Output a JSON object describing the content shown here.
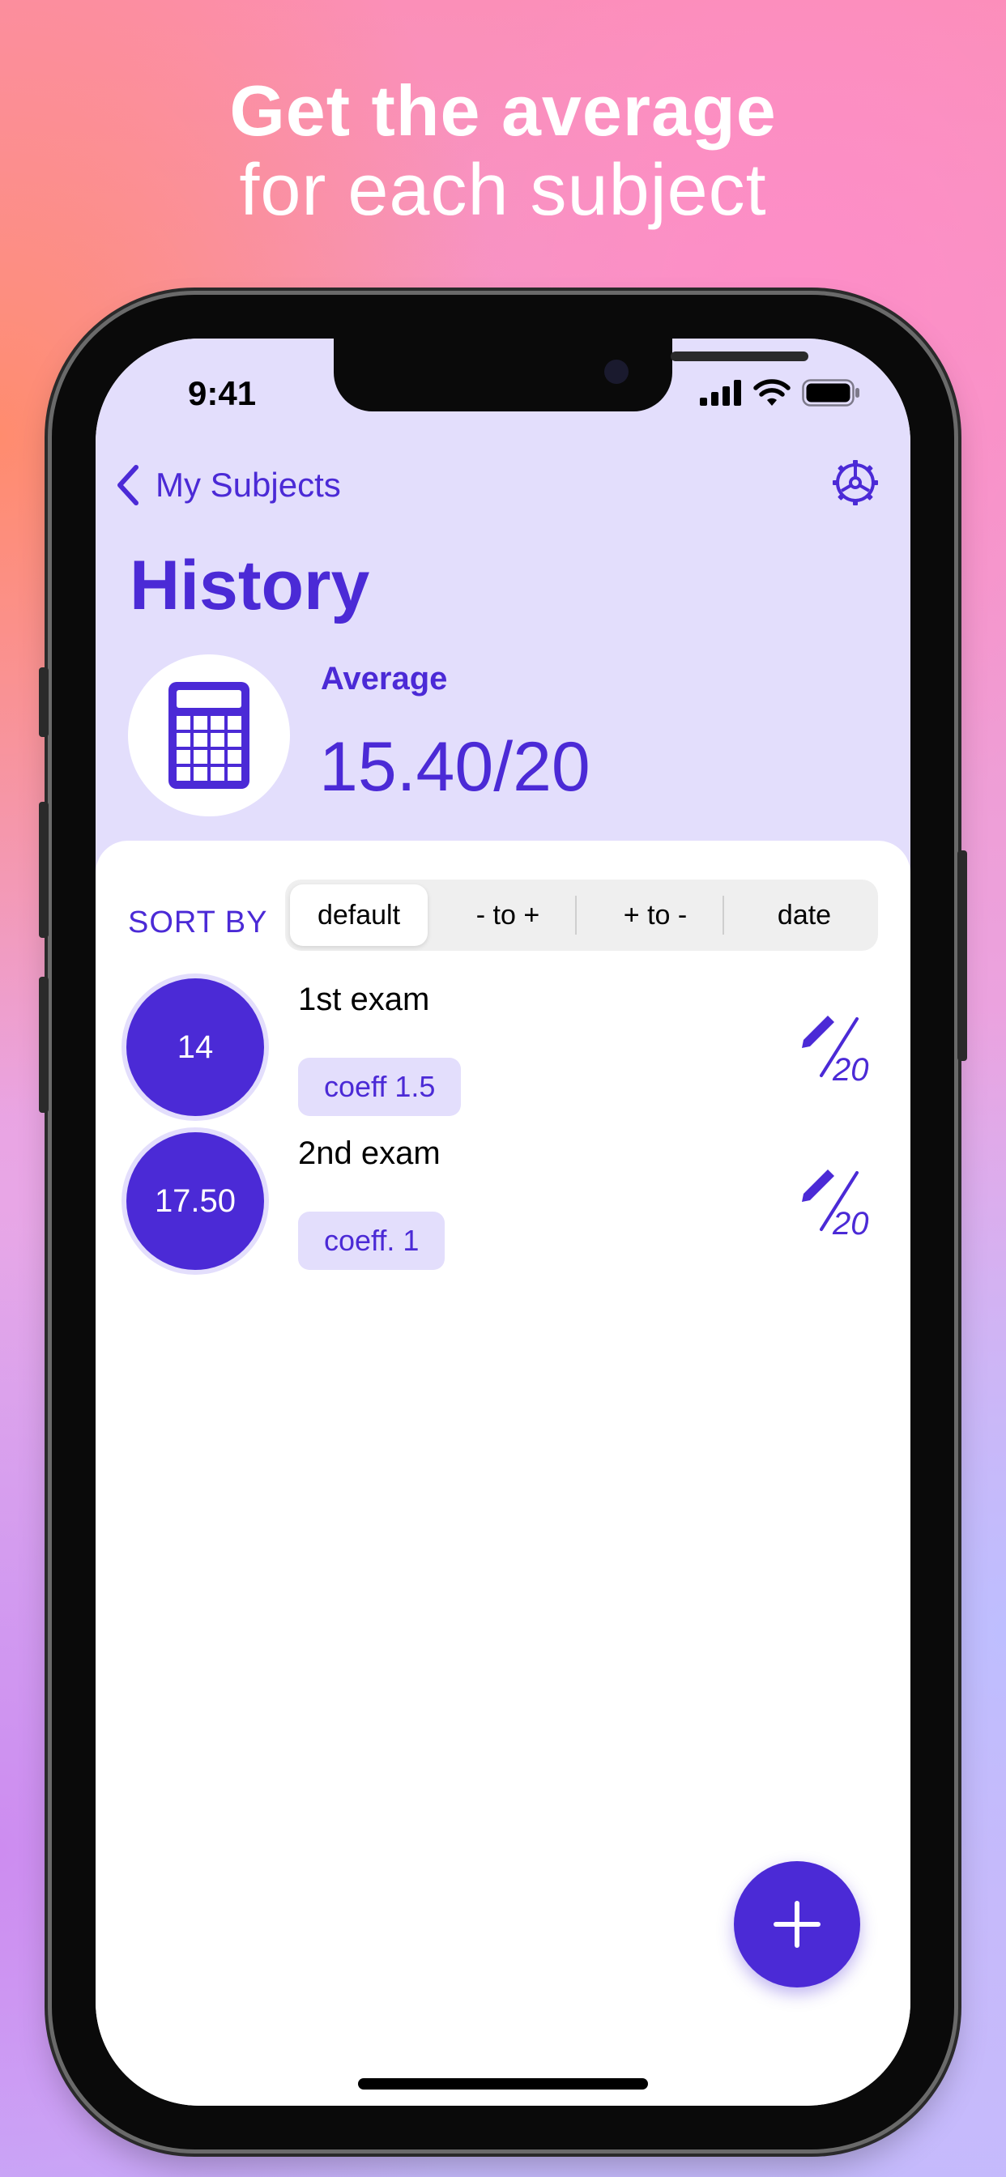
{
  "promo": {
    "headline": "Get the average",
    "subheadline": "for each subject"
  },
  "status_bar": {
    "time": "9:41",
    "icons": [
      "cellular-signal-icon",
      "wifi-icon",
      "battery-icon"
    ]
  },
  "nav": {
    "back_label": "My Subjects",
    "back_icon": "chevron-left-icon",
    "settings_icon": "gear-icon"
  },
  "page": {
    "title": "History",
    "summary_icon": "calculator-icon",
    "average_label": "Average",
    "average_value": "15.40/20"
  },
  "sort": {
    "label": "SORT BY",
    "options": [
      "default",
      "- to +",
      "+ to -",
      "date"
    ],
    "selected": "default"
  },
  "exams": [
    {
      "grade": "14",
      "name": "1st exam",
      "coeff": "coeff 1.5",
      "edit_scale": "20",
      "edit_icon": "pencil-icon"
    },
    {
      "grade": "17.50",
      "name": "2nd exam",
      "coeff": "coeff. 1",
      "edit_scale": "20",
      "edit_icon": "pencil-icon"
    }
  ],
  "fab": {
    "icon": "plus-icon"
  },
  "colors": {
    "accent": "#4b2ad6",
    "header_background": "#e3defc",
    "tag_background": "#e3defc",
    "sheet_background": "#ffffff"
  }
}
